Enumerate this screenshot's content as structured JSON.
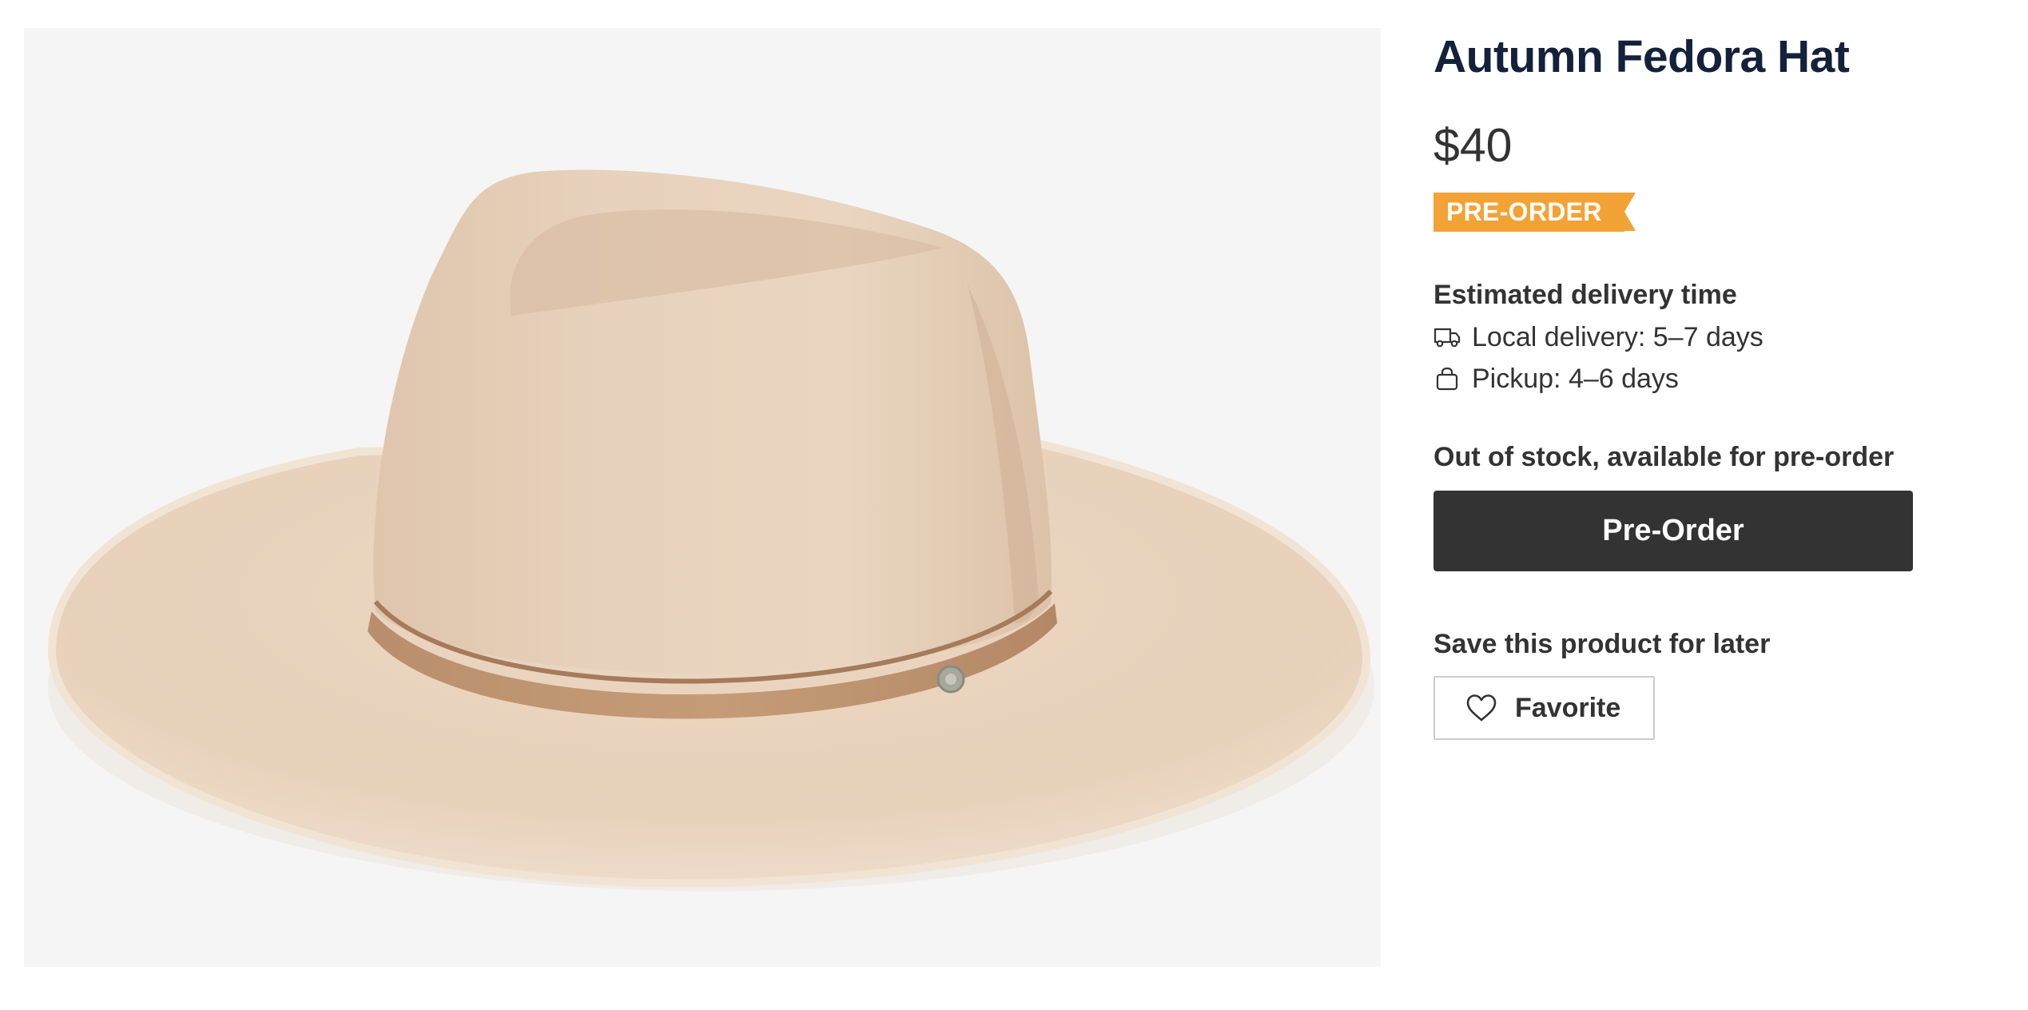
{
  "product": {
    "title": "Autumn Fedora Hat",
    "price": "$40",
    "badge": "PRE-ORDER",
    "image_icon": "fedora-hat-image"
  },
  "delivery": {
    "heading": "Estimated delivery time",
    "local": {
      "icon": "truck-icon",
      "text": "Local delivery: 5–7 days"
    },
    "pickup": {
      "icon": "shopping-bag-icon",
      "text": "Pickup: 4–6 days"
    }
  },
  "stock": {
    "status": "Out of stock, available for pre-order"
  },
  "actions": {
    "preorder_label": "Pre-Order",
    "save_heading": "Save this product for later",
    "favorite_label": "Favorite",
    "favorite_icon": "heart-icon"
  },
  "colors": {
    "badge": "#f3a236",
    "button": "#333333",
    "title": "#14213a"
  }
}
